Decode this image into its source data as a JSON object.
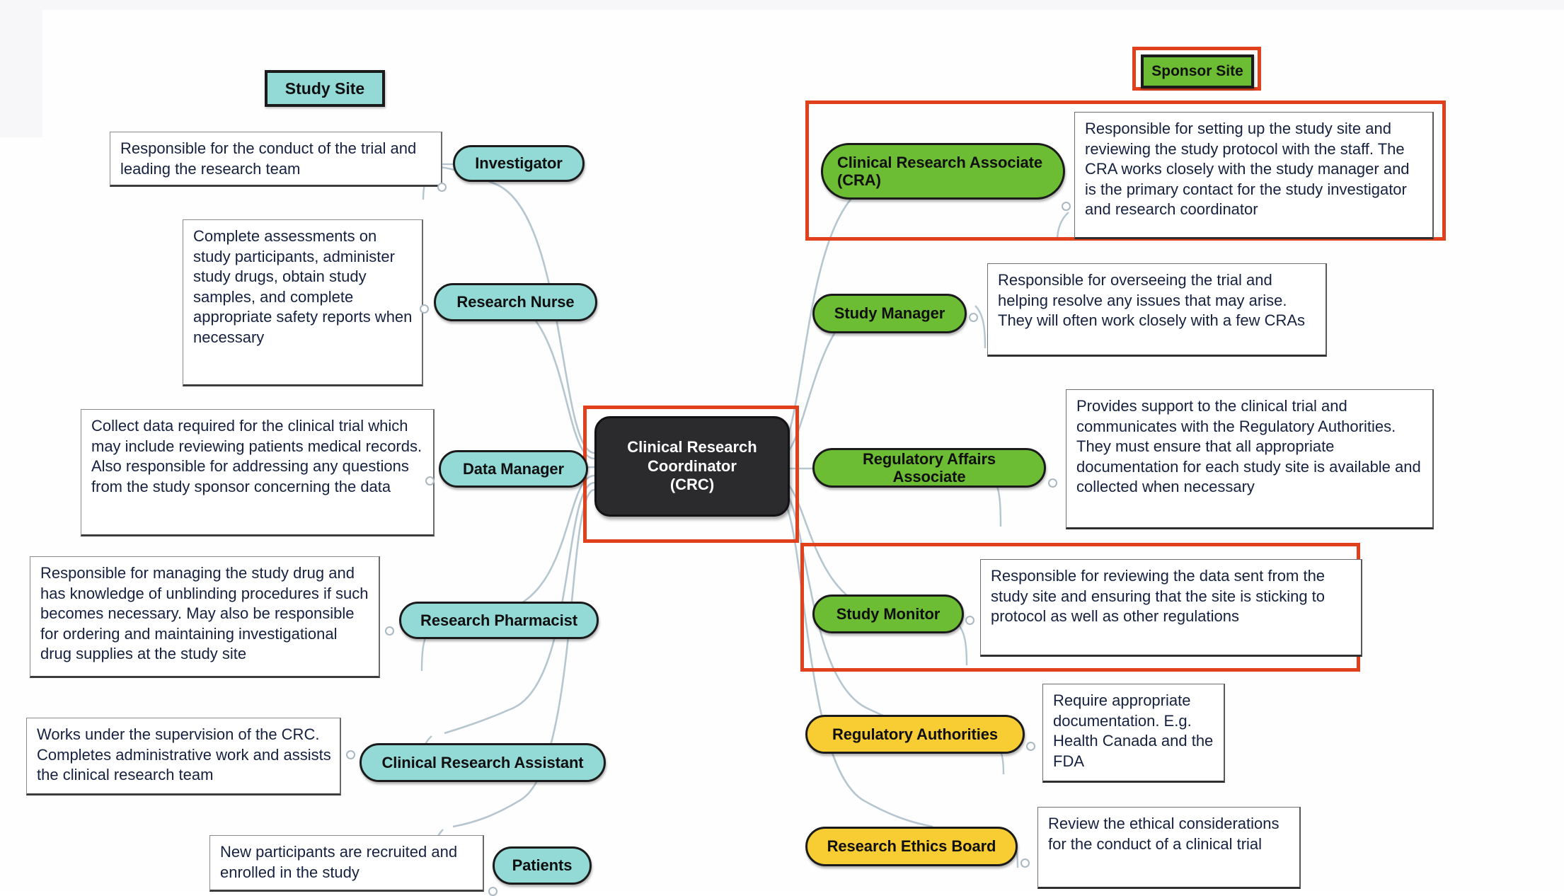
{
  "title": "Clinical Research Coordinator (CRC) Roles Mind Map",
  "colors": {
    "teal": "#93d9d6",
    "green": "#6cbd33",
    "yellow": "#f8cc33",
    "hub": "#2b2b2d",
    "highlight_red": "#e0401c",
    "connector": "#b6c6cf",
    "note_text": "#16213f"
  },
  "hub": {
    "line1": "Clinical Research",
    "line2": "Coordinator",
    "line3": "(CRC)"
  },
  "headers": {
    "left": "Study Site",
    "right": "Sponsor Site"
  },
  "left_branches": [
    {
      "role": "Investigator",
      "note": "Responsible for the conduct of the trial and leading the research team"
    },
    {
      "role": "Research Nurse",
      "note": "Complete assessments on study participants, administer study drugs, obtain study samples, and complete appropriate safety reports when necessary"
    },
    {
      "role": "Data Manager",
      "note": "Collect data required for the clinical trial which may include reviewing patients medical records. Also responsible for addressing any questions from the study sponsor concerning the data"
    },
    {
      "role": "Research Pharmacist",
      "note": "Responsible for managing the study drug and has knowledge of unblinding procedures if such becomes necessary. May also be responsible for ordering and maintaining investigational drug supplies at the study site"
    },
    {
      "role": "Clinical Research Assistant",
      "note": "Works under the supervision of the CRC. Completes administrative work and assists the clinical research team"
    },
    {
      "role": "Patients",
      "note": "New participants are recruited and enrolled in the study"
    }
  ],
  "right_branches": [
    {
      "role": "Clinical Research Associate (CRA)",
      "note": "Responsible for setting up the study site and reviewing the study protocol with the staff. The CRA works closely with the study manager and is the primary contact for the study investigator and research coordinator",
      "highlighted": "true"
    },
    {
      "role": "Study Manager",
      "note": "Responsible for overseeing the trial and helping resolve any issues that may arise. They will often work closely with a few CRAs",
      "highlighted": "false"
    },
    {
      "role": "Regulatory Affairs Associate",
      "note": "Provides support to the clinical trial and communicates with the Regulatory Authorities. They must ensure that all appropriate documentation for each study site is available and collected when necessary",
      "highlighted": "false"
    },
    {
      "role": "Study Monitor",
      "note": "Responsible for reviewing the data sent from the study site and ensuring that the site is sticking to protocol as well as other regulations",
      "highlighted": "true"
    },
    {
      "role": "Regulatory Authorities",
      "note": "Require appropriate documentation. E.g. Health Canada and the FDA",
      "highlighted": "false"
    },
    {
      "role": "Research Ethics Board",
      "note": "Review the ethical considerations for the conduct of a clinical trial",
      "highlighted": "false"
    }
  ]
}
